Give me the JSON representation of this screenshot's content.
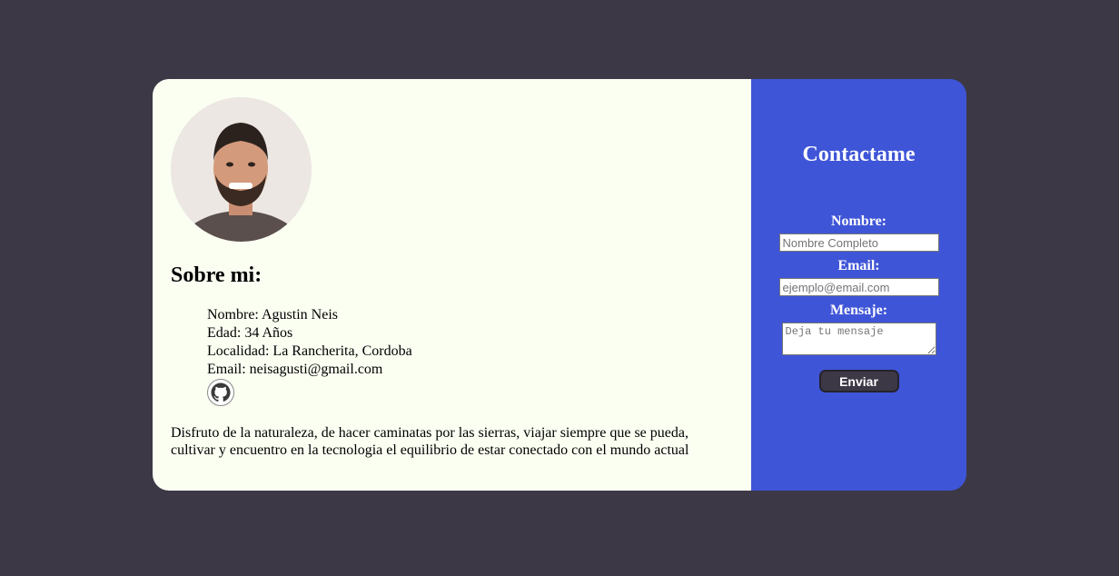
{
  "profile": {
    "about_title": "Sobre mi:",
    "info": [
      "Nombre: Agustin Neis",
      "Edad: 34 Años",
      "Localidad: La Rancherita, Cordoba",
      "Email: neisagusti@gmail.com"
    ],
    "github_icon": "github-icon",
    "bio": "Disfruto de la naturaleza, de hacer caminatas por las sierras, viajar siempre que se pueda, cultivar y encuentro en la tecnologia el equilibrio de estar conectado con el mundo actual"
  },
  "contact": {
    "title": "Contactame",
    "name_label": "Nombre:",
    "name_placeholder": "Nombre Completo",
    "email_label": "Email:",
    "email_placeholder": "ejemplo@email.com",
    "message_label": "Mensaje:",
    "message_placeholder": "Deja tu mensaje",
    "submit_label": "Enviar"
  },
  "colors": {
    "page_background": "#3c3846",
    "card_left": "#fbfff2",
    "card_right": "#3f55d7",
    "button": "#3c3846"
  }
}
